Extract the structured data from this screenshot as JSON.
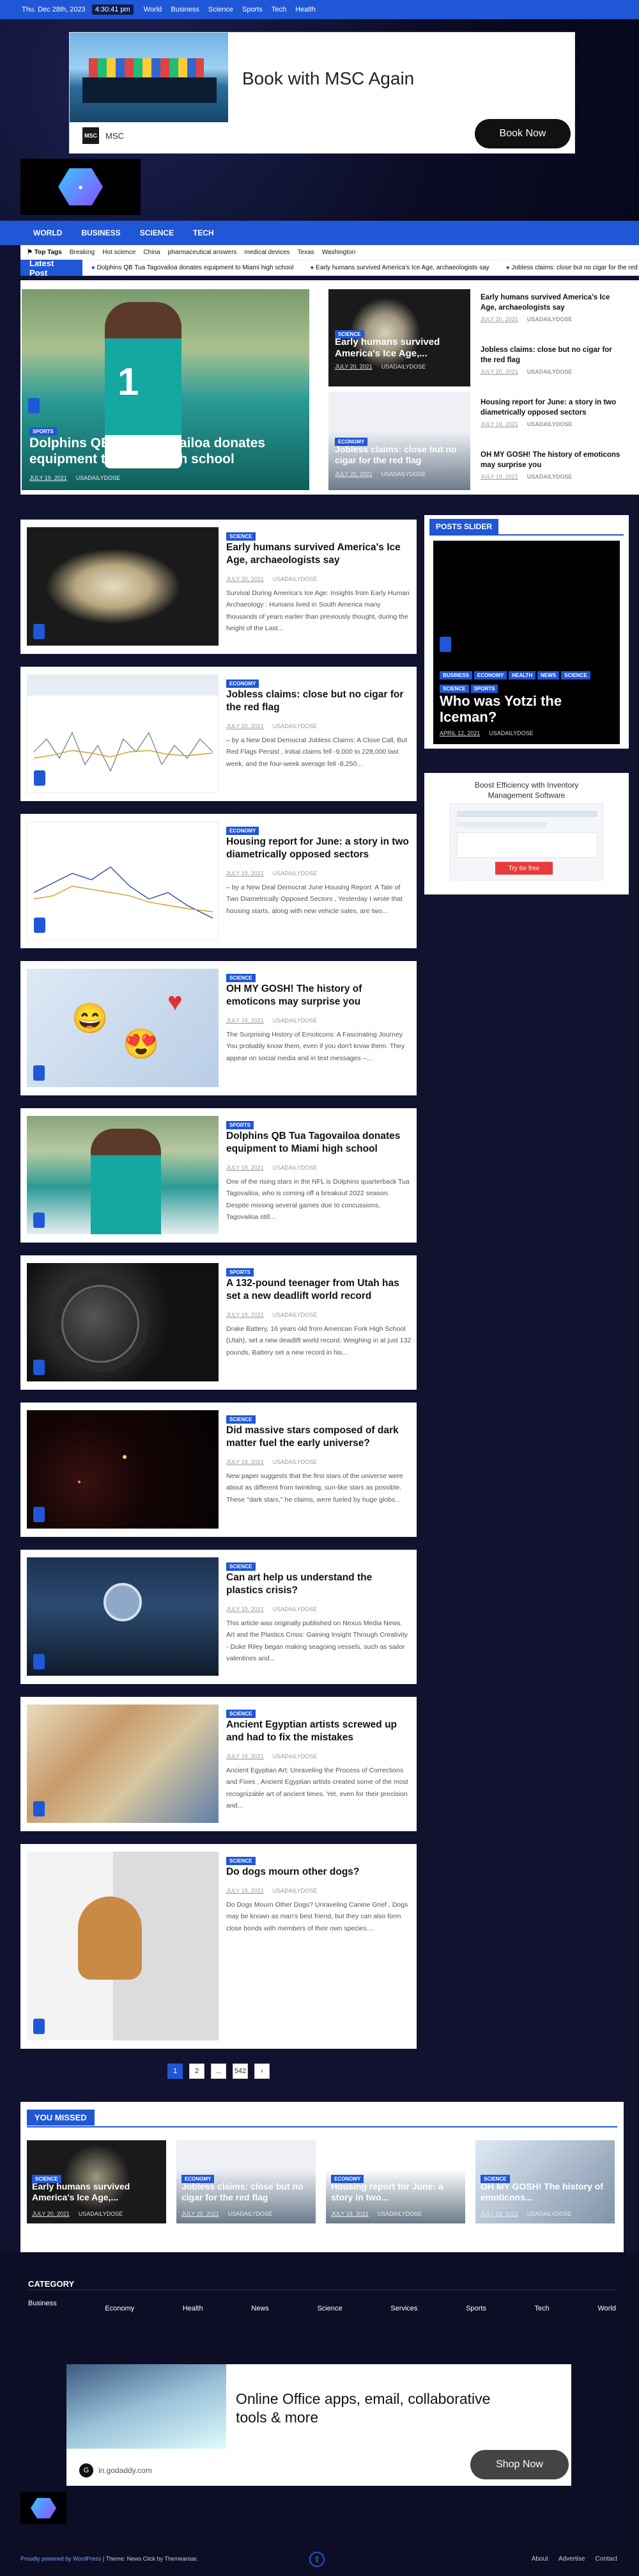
{
  "topbar": {
    "date": "Thu. Dec 28th, 2023",
    "time": "4:30:41 pm",
    "links": [
      "World",
      "Business",
      "Science",
      "Sports",
      "Tech",
      "Health"
    ]
  },
  "ad_top": {
    "headline": "Book with MSC Again",
    "brand": "MSC",
    "cta": "Book Now",
    "brand_mark": "MSC"
  },
  "nav": {
    "items": [
      "WORLD",
      "BUSINESS",
      "SCIENCE",
      "TECH"
    ]
  },
  "tags": {
    "label": "Top Tags",
    "items": [
      "Breaking",
      "Hot science",
      "China",
      "pharmaceutical answers",
      "medical devices",
      "Texas",
      "Washington"
    ]
  },
  "latest": {
    "label": "Latest Post",
    "items": [
      "Dolphins QB Tua Tagovailoa donates equipment to Miami high school",
      "Early humans survived America's Ice Age, archaeologists say",
      "Jobless claims: close but no cigar for the red flag"
    ]
  },
  "hero": {
    "main": {
      "cat": "SPORTS",
      "title": "Dolphins QB Tua Tagovailoa donates equipment to Miami high school",
      "date": "JULY 19, 2021",
      "author": "USADAILYDOSE"
    },
    "mid_top": {
      "cats": [
        "SCIENCE"
      ],
      "title": "Early humans survived America's Ice Age,...",
      "date": "JULY 20, 2021",
      "author": "USADAILYDOSE"
    },
    "mid_bottom": {
      "cats": [
        "ECONOMY"
      ],
      "title": "Jobless claims: close but no cigar for the red flag",
      "date": "JULY 20, 2021",
      "author": "USADAILYDOSE"
    },
    "side": [
      {
        "title": "Early humans survived America's Ice Age, archaeologists say",
        "date": "JULY 20, 2021",
        "author": "USADAILYDOSE"
      },
      {
        "title": "Jobless claims: close but no cigar for the red flag",
        "date": "JULY 20, 2021",
        "author": "USADAILYDOSE"
      },
      {
        "title": "Housing report for June: a story in two diametrically opposed sectors",
        "date": "JULY 19, 2021",
        "author": "USADAILYDOSE"
      },
      {
        "title": "OH MY GOSH! The history of emoticons may surprise you",
        "date": "JULY 19, 2021",
        "author": "USADAILYDOSE"
      }
    ]
  },
  "posts": [
    {
      "cat": "SCIENCE",
      "title": "Early humans survived America's Ice Age, archaeologists say",
      "date": "JULY 20, 2021",
      "author": "USADAILYDOSE",
      "excerpt": "Survival During America's Ice Age: Insights from Early Human Archaeology : Humans lived in South America many thousands of years earlier than previously thought, during the height of the Last..."
    },
    {
      "cat": "ECONOMY",
      "title": "Jobless claims: close but no cigar for the red flag",
      "date": "JULY 20, 2021",
      "author": "USADAILYDOSE",
      "excerpt": "– by a New Deal Democrat Jobless Claims: A Close Call, But Red Flags Persist , Initial claims fell -9,000 to 228,000 last week, and the four-week average fell -8,250..."
    },
    {
      "cat": "ECONOMY",
      "title": "Housing report for June: a story in two diametrically opposed sectors",
      "date": "JULY 19, 2021",
      "author": "USADAILYDOSE",
      "excerpt": "– by a New Deal Democrat June Housing Report: A Tale of Two Diametrically Opposed Sectors , Yesterday I wrote that housing starts, along with new vehicle sales, are two..."
    },
    {
      "cat": "SCIENCE",
      "title": "OH MY GOSH! The history of emoticons may surprise you",
      "date": "JULY 19, 2021",
      "author": "USADAILYDOSE",
      "excerpt": "The Surprising History of Emoticons: A Fascinating Journey You probably know them, even if you don't know them. They appear on social media and in text messages –..."
    },
    {
      "cat": "SPORTS",
      "title": "Dolphins QB Tua Tagovailoa donates equipment to Miami high school",
      "date": "JULY 19, 2021",
      "author": "USADAILYDOSE",
      "excerpt": "One of the rising stars in the NFL is Dolphins quarterback Tua Tagovailoa, who is coming off a breakout 2022 season. Despite missing several games due to concussions, Tagovailoa still..."
    },
    {
      "cat": "SPORTS",
      "title": "A 132-pound teenager from Utah has set a new deadlift world record",
      "date": "JULY 19, 2021",
      "author": "USADAILYDOSE",
      "excerpt": "Drake Battery, 16 years old from American Fork High School (Utah), set a new deadlift world record. Weighing in at just 132 pounds, Battery set a new record in his..."
    },
    {
      "cat": "SCIENCE",
      "title": "Did massive stars composed of dark matter fuel the early universe?",
      "date": "JULY 19, 2021",
      "author": "USADAILYDOSE",
      "excerpt": "New paper suggests that the first stars of the universe were about as different from twinkling, sun-like stars as possible. These \"dark stars,\" he claims, were fueled by huge globs..."
    },
    {
      "cat": "SCIENCE",
      "title": "Can art help us understand the plastics crisis?",
      "date": "JULY 19, 2021",
      "author": "USADAILYDOSE",
      "excerpt": "This article was originally published on Nexus Media News. Art and the Plastics Crisis: Gaining Insight Through Creativity - Duke Riley began making seagoing vessels, such as sailor valentines and..."
    },
    {
      "cat": "SCIENCE",
      "title": "Ancient Egyptian artists screwed up and had to fix the mistakes",
      "date": "JULY 19, 2021",
      "author": "USADAILYDOSE",
      "excerpt": "Ancient Egyptian Art: Unraveling the Process of Corrections and Fixes , Ancient Egyptian artists created some of the most recognizable art of ancient times. Yet, even for their precision and..."
    },
    {
      "cat": "SCIENCE",
      "title": "Do dogs mourn other dogs?",
      "date": "JULY 19, 2021",
      "author": "USADAILYDOSE",
      "excerpt": "Do Dogs Mourn Other Dogs? Unraveling Canine Grief , Dogs may be known as man's best friend, but they can also form close bonds with members of their own species...."
    }
  ],
  "slider": {
    "heading": "POSTS SLIDER",
    "cats": [
      "BUSINESS",
      "ECONOMY",
      "HEALTH",
      "NEWS",
      "SCIENCE",
      "SCIENCE",
      "SPORTS"
    ],
    "title": "Who was Yotzi the Iceman?",
    "date": "APRIL 12, 2021",
    "author": "USADAILYDOSE"
  },
  "side_ad": {
    "title": "Boost Efficiency with Inventory Management Software",
    "cta": "Try for free"
  },
  "pagination": [
    "1",
    "2",
    "...",
    "542",
    "›"
  ],
  "missed": {
    "heading": "YOU MISSED",
    "items": [
      {
        "cat": "SCIENCE",
        "title": "Early humans survived America's Ice Age,...",
        "date": "JULY 20, 2021",
        "author": "USADAILYDOSE"
      },
      {
        "cat": "ECONOMY",
        "title": "Jobless claims: close but no cigar for the red flag",
        "date": "JULY 20, 2021",
        "author": "USADAILYDOSE"
      },
      {
        "cat": "ECONOMY",
        "title": "Housing report for June: a story in two...",
        "date": "JULY 19, 2021",
        "author": "USADAILYDOSE"
      },
      {
        "cat": "SCIENCE",
        "title": "OH MY GOSH! The history of emoticons...",
        "date": "JULY 19, 2021",
        "author": "USADAILYDOSE"
      }
    ]
  },
  "footer": {
    "category_title": "CATEGORY",
    "links": [
      "Business",
      "Economy",
      "Health",
      "News",
      "Science",
      "Services",
      "Sports",
      "Tech",
      "World"
    ],
    "ad": {
      "headline": "Online Office apps, email, collaborative tools & more",
      "domain": "in.godaddy.com",
      "cta": "Shop Now"
    },
    "copyright": "Proudly powered by WordPress",
    "theme": " | Theme: News Click by Themeansar.",
    "bottom_links": [
      "About",
      "Advertise",
      "Contact"
    ]
  },
  "colors": {
    "accent": "#1f57d6",
    "dark_bg": "#111230"
  }
}
